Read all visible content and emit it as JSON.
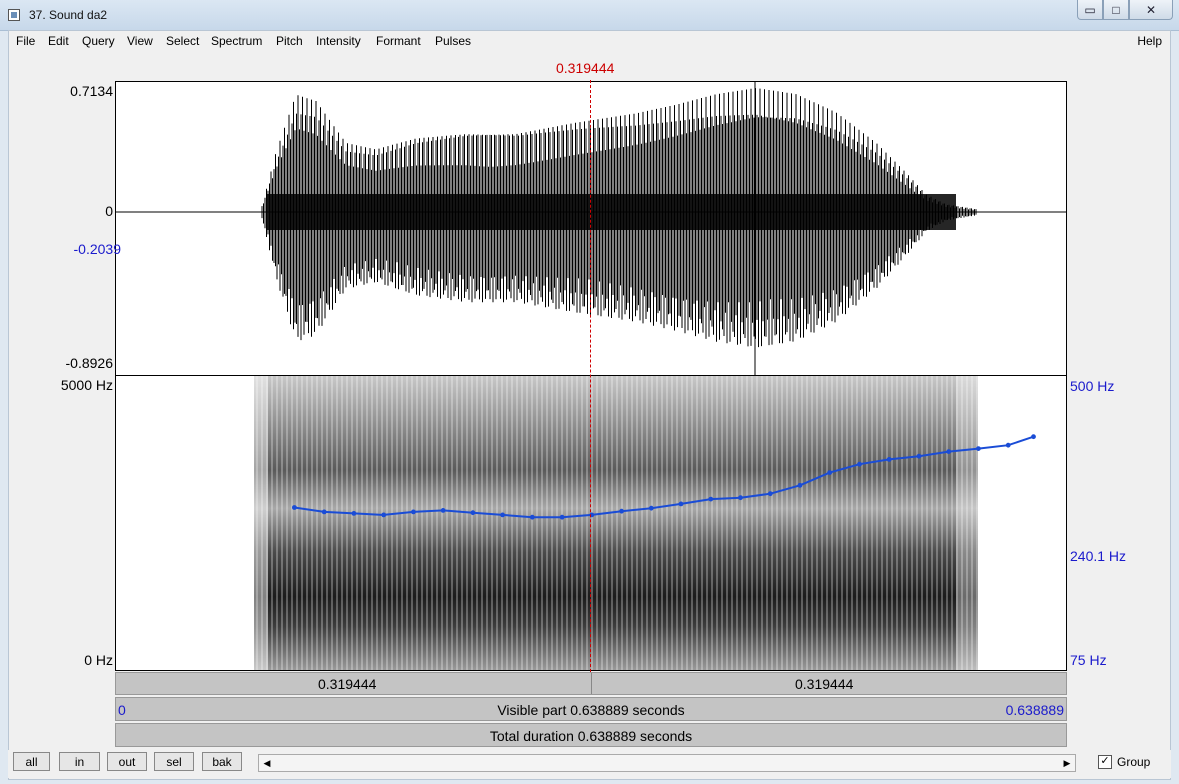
{
  "window": {
    "title": "37. Sound da2",
    "controls": {
      "minimize": "▭",
      "maximize": "□",
      "close": "✕"
    }
  },
  "menu": {
    "items": [
      "File",
      "Edit",
      "Query",
      "View",
      "Select",
      "Spectrum",
      "Pitch",
      "Intensity",
      "Formant",
      "Pulses"
    ],
    "help": "Help"
  },
  "cursor": {
    "time_label": "0.319444",
    "time": 0.319444
  },
  "waveform": {
    "max_label": "0.7134",
    "zero_label": "0",
    "cursor_value_label": "-0.2039",
    "min_label": "-0.8926"
  },
  "spectrogram": {
    "freq_top": "5000 Hz",
    "freq_bottom": "0 Hz",
    "pitch_top": "500 Hz",
    "pitch_cursor": "240.1 Hz",
    "pitch_bottom": "75 Hz"
  },
  "selection_bar": {
    "left_label": "0.319444",
    "right_label": "0.319444"
  },
  "visible_bar": {
    "start": "0",
    "text": "Visible part 0.638889 seconds",
    "end": "0.638889"
  },
  "total_bar": {
    "text": "Total duration 0.638889 seconds"
  },
  "buttons": {
    "all": "all",
    "in": "in",
    "out": "out",
    "sel": "sel",
    "bak": "bak"
  },
  "scroll": {
    "left_arrow": "◀",
    "right_arrow": "▶"
  },
  "group": {
    "label": "Group",
    "checked": true,
    "check_mark": "✓"
  },
  "chart_data": {
    "type": "line",
    "title": "",
    "x_range": [
      0,
      0.638889
    ],
    "pitch_range_hz": [
      75,
      500
    ],
    "pitch_scale": "log",
    "series": [
      {
        "x": [
          0.12,
          0.14,
          0.16,
          0.18,
          0.2,
          0.22,
          0.24,
          0.26,
          0.28,
          0.3,
          0.32,
          0.34,
          0.36,
          0.38,
          0.4,
          0.42,
          0.44,
          0.46,
          0.48,
          0.5,
          0.52,
          0.54,
          0.56,
          0.58,
          0.6,
          0.617
        ],
        "y": [
          214,
          208,
          206,
          204,
          208,
          210,
          207,
          204,
          201,
          201,
          204,
          209,
          213,
          219,
          226,
          228,
          234,
          247,
          268,
          283,
          292,
          298,
          307,
          313,
          320,
          338
        ]
      }
    ],
    "pitch_color": "#1a4cd6",
    "cursor_color": "#cc0000"
  }
}
